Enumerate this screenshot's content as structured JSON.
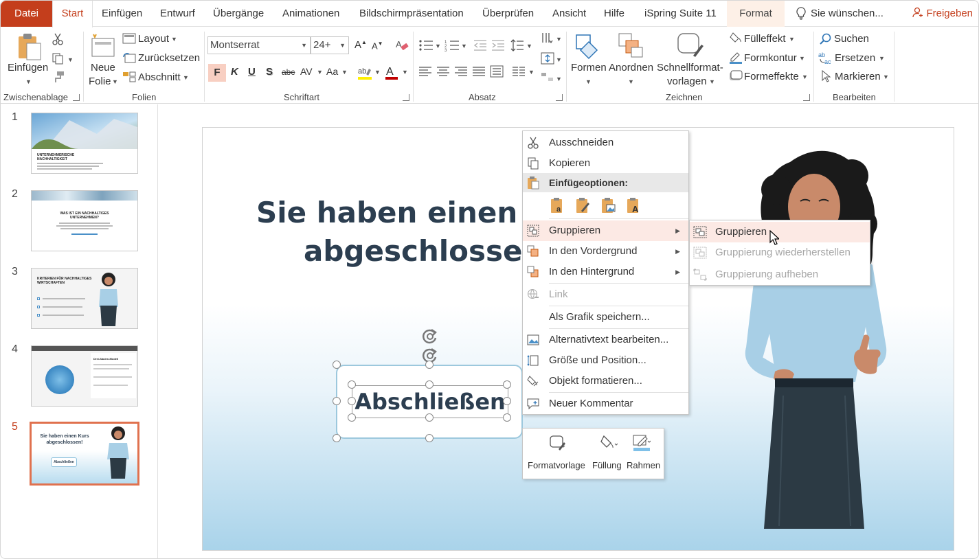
{
  "tabs": {
    "datei": "Datei",
    "start": "Start",
    "einfuegen": "Einfügen",
    "entwurf": "Entwurf",
    "uebergaenge": "Übergänge",
    "animationen": "Animationen",
    "praesentation": "Bildschirmpräsentation",
    "ueberpruefen": "Überprüfen",
    "ansicht": "Ansicht",
    "hilfe": "Hilfe",
    "ispring": "iSpring Suite 11",
    "format": "Format",
    "tellme": "Sie wünschen...",
    "share": "Freigeben"
  },
  "ribbon": {
    "clipboard": {
      "paste": "Einfügen",
      "label": "Zwischenablage"
    },
    "slides": {
      "new_slide_1": "Neue",
      "new_slide_2": "Folie",
      "layout": "Layout",
      "reset": "Zurücksetzen",
      "section": "Abschnitt",
      "label": "Folien"
    },
    "font": {
      "family": "Montserrat",
      "size": "24+",
      "bold": "F",
      "italic": "K",
      "underline": "U",
      "shadow": "S",
      "strike": "abc",
      "spacing": "AV",
      "case": "Aa",
      "label": "Schriftart"
    },
    "paragraph": {
      "label": "Absatz"
    },
    "drawing": {
      "shapes": "Formen",
      "arrange": "Anordnen",
      "quickstyles_1": "Schnellformat-",
      "quickstyles_2": "vorlagen",
      "fill": "Fülleffekt",
      "outline": "Formkontur",
      "effects": "Formeffekte",
      "label": "Zeichnen"
    },
    "editing": {
      "find": "Suchen",
      "replace": "Ersetzen",
      "select": "Markieren",
      "label": "Bearbeiten"
    }
  },
  "slides_panel": {
    "numbers": [
      "1",
      "2",
      "3",
      "4",
      "5"
    ],
    "selected": "5",
    "thumb5_title_1": "Sie haben einen Kurs",
    "thumb5_title_2": "abgeschlossen!",
    "thumb5_button": "Abschließen",
    "thumb2_title_1": "WAS IST EIN NACHHALTIGES",
    "thumb2_title_2": "UNTERNEHMEN?",
    "thumb3_title_1": "KRITERIEN FÜR NACHHALTIGES",
    "thumb3_title_2": "WIRTSCHAFTEN",
    "thumb1_title_1": "UNTERNEHMERISCHE",
    "thumb1_title_2": "NACHHALTIGKEIT",
    "thumb4_title": "Drei-Säulen-Modell"
  },
  "slide": {
    "title_line1": "Sie haben einen Kurs",
    "title_line2": "abgeschlossen!",
    "button_text": "Abschließen"
  },
  "context_menu": {
    "cut": "Ausschneiden",
    "copy": "Kopieren",
    "paste_options": "Einfügeoptionen:",
    "group": "Gruppieren",
    "bring_forward": "In den Vordergrund",
    "send_backward": "In den Hintergrund",
    "link": "Link",
    "save_as_picture": "Als Grafik speichern...",
    "alt_text": "Alternativtext bearbeiten...",
    "size_position": "Größe und Position...",
    "format_object": "Objekt formatieren...",
    "new_comment": "Neuer Kommentar"
  },
  "submenu": {
    "group": "Gruppieren",
    "regroup": "Gruppierung wiederherstellen",
    "ungroup": "Gruppierung aufheben"
  },
  "mini_toolbar": {
    "style": "Formatvorlage",
    "fill": "Füllung",
    "outline": "Rahmen"
  },
  "colors": {
    "accent": "#c43e1c",
    "highlight": "#fce9e4",
    "title_text": "#2c3e50",
    "format_tab": "#fdf0e7"
  }
}
